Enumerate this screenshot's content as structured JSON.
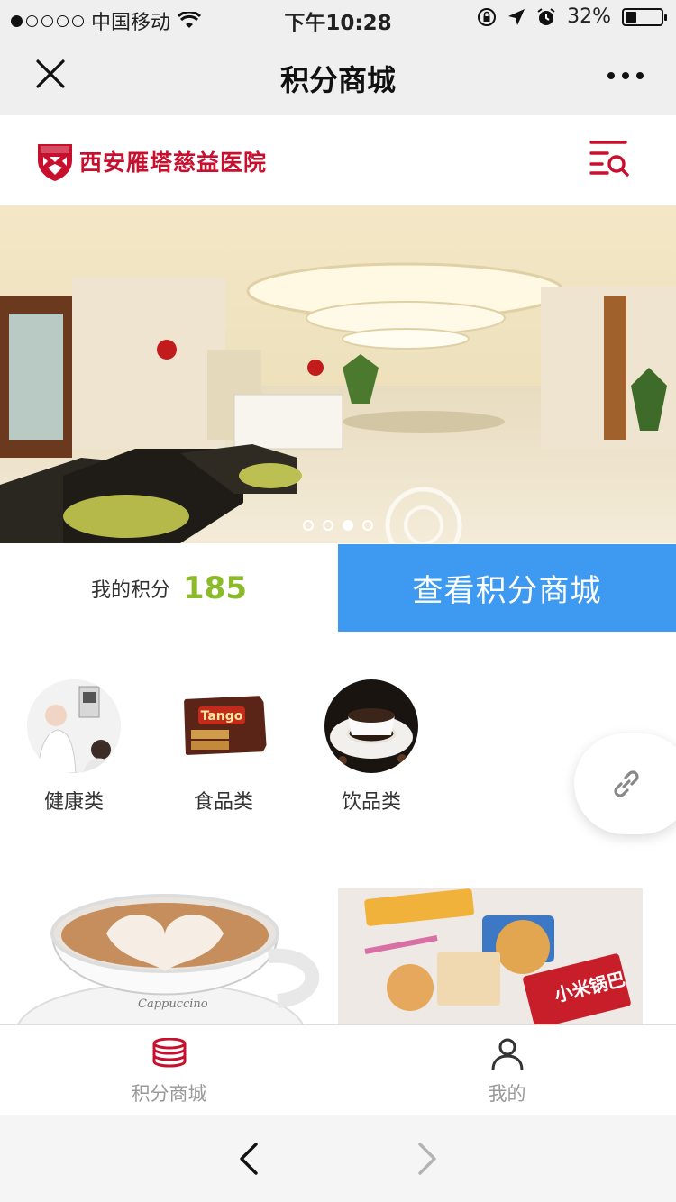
{
  "status_bar": {
    "carrier": "中国移动",
    "time": "下午10:28",
    "battery": "32%",
    "battery_level": 0.32
  },
  "nav": {
    "title": "积分商城"
  },
  "header": {
    "hospital_name": "西安雁塔慈益医院",
    "logo_text": "慈益"
  },
  "banner": {
    "slide_count": 4,
    "active_slide": 3
  },
  "points": {
    "label": "我的积分",
    "value": "185",
    "button_label": "查看积分商城"
  },
  "categories": [
    {
      "label": "健康类",
      "icon": "health-image"
    },
    {
      "label": "食品类",
      "icon": "food-image"
    },
    {
      "label": "饮品类",
      "icon": "drink-image"
    }
  ],
  "tabbar": {
    "items": [
      {
        "label": "积分商城",
        "icon": "coins-stack-icon",
        "active": true
      },
      {
        "label": "我的",
        "icon": "user-icon",
        "active": false
      }
    ]
  },
  "colors": {
    "brand_red": "#c8102e",
    "accent_blue": "#3d9af0",
    "points_green": "#8cbb2a"
  }
}
